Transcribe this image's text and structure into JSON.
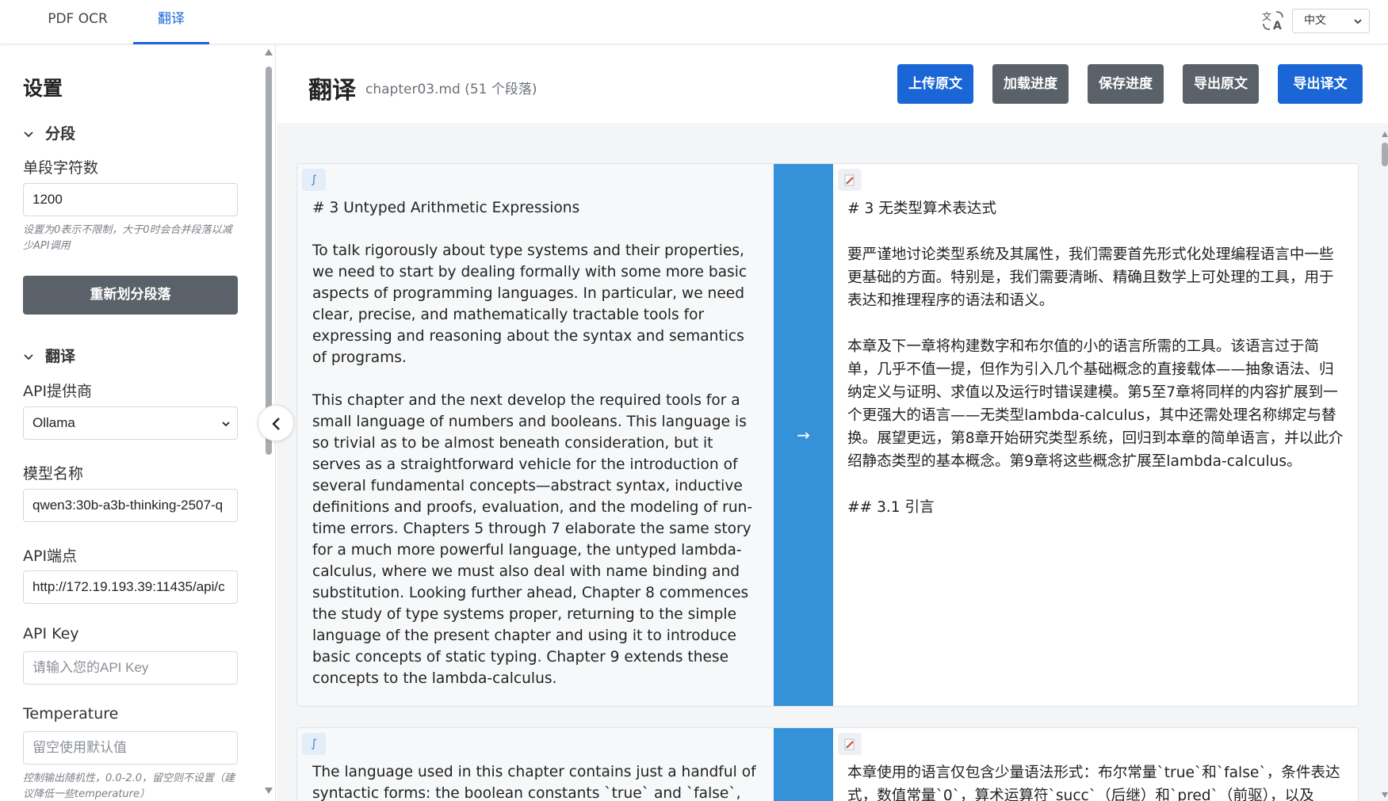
{
  "tabs": [
    {
      "label": "PDF OCR",
      "active": false
    },
    {
      "label": "翻译",
      "active": true
    }
  ],
  "language_select": {
    "value": "中文"
  },
  "sidebar": {
    "title": "设置",
    "segment_section": {
      "title": "分段",
      "char_label": "单段字符数",
      "char_value": "1200",
      "char_hint": "设置为0表示不限制，大于0时会合并段落以减少API调用",
      "resegment_button": "重新划分段落"
    },
    "translate_section": {
      "title": "翻译",
      "provider_label": "API提供商",
      "provider_value": "Ollama",
      "model_label": "模型名称",
      "model_value": "qwen3:30b-a3b-thinking-2507-q",
      "endpoint_label": "API端点",
      "endpoint_value": "http://172.19.193.39:11435/api/c",
      "key_label": "API Key",
      "key_placeholder": "请输入您的API Key",
      "temperature_label": "Temperature",
      "temperature_placeholder": "留空使用默认值",
      "temperature_hint": "控制输出随机性，0.0-2.0，留空则不设置（建议降低一些temperature）"
    }
  },
  "header": {
    "title": "翻译",
    "subtitle": "chapter03.md (51 个段落)",
    "buttons": {
      "upload": "上传原文",
      "load": "加载进度",
      "save": "保存进度",
      "export_source": "导出原文",
      "export_translation": "导出译文"
    }
  },
  "paragraphs": [
    {
      "source_badge": "∫",
      "arrow": "→",
      "source": "# 3 Untyped Arithmetic Expressions\n\nTo talk rigorously about type systems and their properties, we need to start by dealing formally with some more basic aspects of programming languages. In particular, we need clear, precise, and mathematically tractable tools for expressing and reasoning about the syntax and semantics of programs.\n\nThis chapter and the next develop the required tools for a small language of numbers and booleans. This language is so trivial as to be almost beneath consideration, but it serves as a straightforward vehicle for the introduction of several fundamental concepts—abstract syntax, inductive definitions and proofs, evaluation, and the modeling of run-time errors. Chapters 5 through 7 elaborate the same story for a much more powerful language, the untyped lambda-calculus, where we must also deal with name binding and substitution. Looking further ahead, Chapter 8 commences the study of type systems proper, returning to the simple language of the present chapter and using it to introduce basic concepts of static typing. Chapter 9 extends these concepts to the lambda-calculus.\n\n## 3.1 Introduction",
      "target": "# 3 无类型算术表达式\n\n要严谨地讨论类型系统及其属性，我们需要首先形式化处理编程语言中一些更基础的方面。特别是，我们需要清晰、精确且数学上可处理的工具，用于表达和推理程序的语法和语义。\n\n本章及下一章将构建数字和布尔值的小的语言所需的工具。该语言过于简单，几乎不值一提，但作为引入几个基础概念的直接载体——抽象语法、归纳定义与证明、求值以及运行时错误建模。第5至7章将同样的内容扩展到一个更强大的语言——无类型lambda-calculus，其中还需处理名称绑定与替换。展望更远，第8章开始研究类型系统，回归到本章的简单语言，并以此介绍静态类型的基本概念。第9章将这些概念扩展至lambda-calculus。\n\n## 3.1 引言"
    },
    {
      "source_badge": "∫",
      "arrow": "→",
      "source": "The language used in this chapter contains just a handful of syntactic forms: the boolean constants `true` and `false`,",
      "target": "本章使用的语言仅包含少量语法形式：布尔常量`true`和`false`，条件表达式，数值常量`0`，算术运算符`succ`（后继）和`pred`（前驱），以及"
    }
  ]
}
